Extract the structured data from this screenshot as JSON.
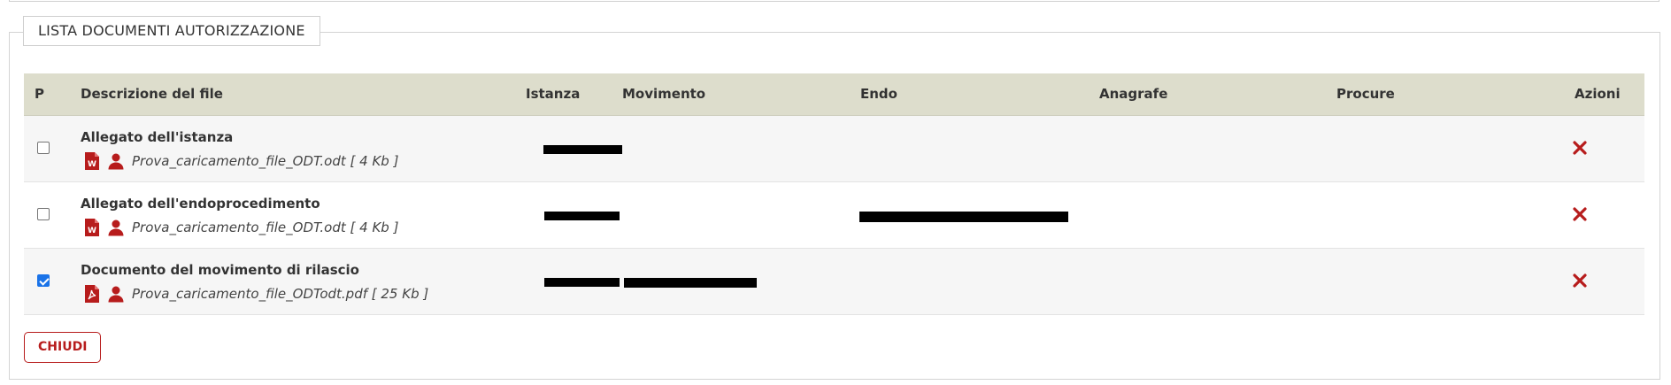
{
  "panel": {
    "legend": "LISTA DOCUMENTI AUTORIZZAZIONE"
  },
  "table": {
    "headers": {
      "p": "P",
      "descrizione": "Descrizione del file",
      "istanza": "Istanza",
      "movimento": "Movimento",
      "endo": "Endo",
      "anagrafe": "Anagrafe",
      "procure": "Procure",
      "azioni": "Azioni"
    },
    "rows": [
      {
        "checked": false,
        "title": "Allegato dell'istanza",
        "file": "Prova_caricamento_file_ODT.odt [ 4 Kb ]",
        "file_icon": "word-file-icon"
      },
      {
        "checked": false,
        "title": "Allegato dell'endoprocedimento",
        "file": "Prova_caricamento_file_ODT.odt [ 4 Kb ]",
        "file_icon": "word-file-icon"
      },
      {
        "checked": true,
        "title": "Documento del movimento di rilascio",
        "file": "Prova_caricamento_file_ODTodt.pdf [ 25 Kb ]",
        "file_icon": "pdf-file-icon"
      }
    ]
  },
  "buttons": {
    "close": "CHIUDI"
  },
  "colors": {
    "accent": "#b71c1c",
    "header_bg": "#ddddcc",
    "checkbox_checked": "#1a73e8"
  }
}
